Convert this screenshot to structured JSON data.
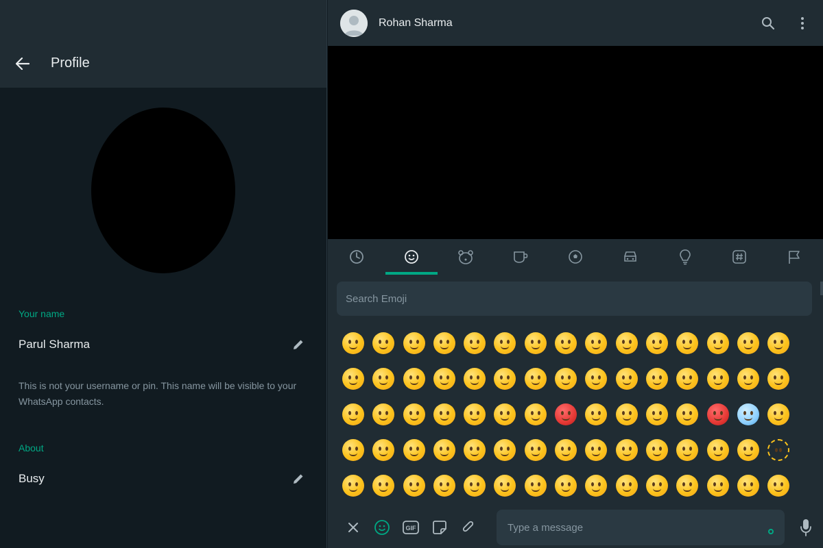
{
  "profile": {
    "title": "Profile",
    "name_label": "Your name",
    "name_value": "Parul Sharma",
    "name_helper": "This is not your username or pin. This name will be visible to your WhatsApp contacts.",
    "about_label": "About",
    "about_value": "Busy"
  },
  "chat": {
    "contact_name": "Rohan Sharma"
  },
  "emoji_panel": {
    "tabs": [
      {
        "icon": "clock-icon",
        "active": false
      },
      {
        "icon": "smiley-icon",
        "active": true
      },
      {
        "icon": "bear-icon",
        "active": false
      },
      {
        "icon": "cup-icon",
        "active": false
      },
      {
        "icon": "soccer-ball-icon",
        "active": false
      },
      {
        "icon": "car-icon",
        "active": false
      },
      {
        "icon": "lightbulb-icon",
        "active": false
      },
      {
        "icon": "hash-icon",
        "active": false
      },
      {
        "icon": "flag-icon",
        "active": false
      }
    ],
    "search_placeholder": "Search Emoji",
    "rows": 5,
    "columns": 15
  },
  "composer": {
    "placeholder": "Type a message",
    "gif_label": "GIF"
  },
  "colors": {
    "accent": "#00a884",
    "panel_bg": "#111b21",
    "header_bg": "#202c33",
    "input_bg": "#2a3942",
    "primary_text": "#e9edef",
    "secondary_text": "#8696a0"
  }
}
